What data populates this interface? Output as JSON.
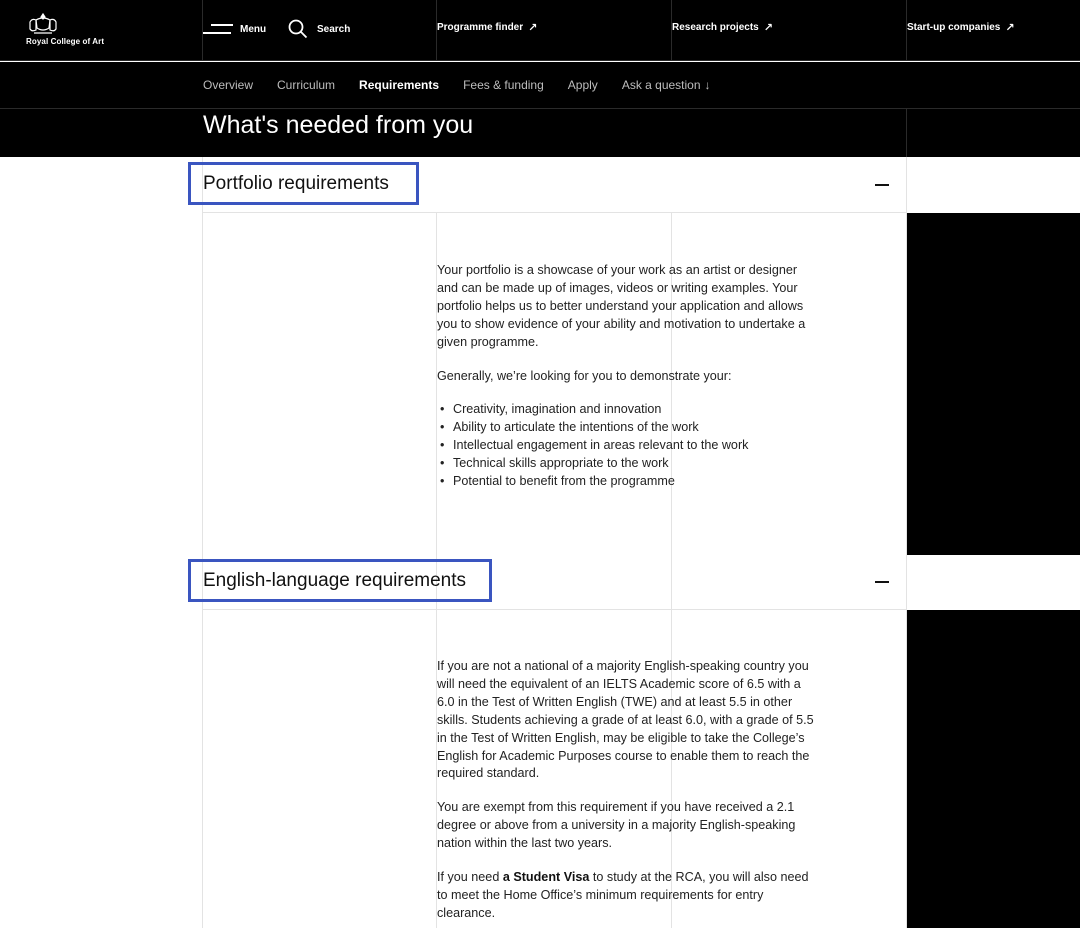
{
  "header": {
    "logo_text": "Royal College of Art",
    "menu_label": "Menu",
    "search_label": "Search",
    "links": [
      {
        "label": "Programme finder",
        "icon": "arrow-up-right-icon"
      },
      {
        "label": "Research projects",
        "icon": "arrow-up-right-icon"
      },
      {
        "label": "Start-up companies",
        "icon": "arrow-up-right-icon"
      }
    ],
    "arrow_glyph": "↗"
  },
  "subnav": {
    "items": [
      "Overview",
      "Curriculum",
      "Requirements",
      "Fees & funding",
      "Apply",
      "Ask a question"
    ],
    "active": "Requirements",
    "down_glyph": "↓"
  },
  "hero": {
    "title": "What's needed from you"
  },
  "portfolio": {
    "heading": "Portfolio requirements",
    "para1": "Your portfolio is a showcase of your work as an artist or designer and can be made up of images, videos or writing examples. Your portfolio helps us to better understand your application and allows you to show evidence of your ability and motivation to undertake a given programme.",
    "para2": "Generally, we’re looking for you to demonstrate your:",
    "bullets": [
      "Creativity, imagination and innovation",
      "Ability to articulate the intentions of the work",
      "Intellectual engagement in areas relevant to the work",
      "Technical skills appropriate to the work",
      "Potential to benefit from the programme"
    ]
  },
  "english": {
    "heading": "English-language requirements",
    "para1": "If you are not a national of a majority English-speaking country you will need the equivalent of an IELTS Academic score of 6.5 with a 6.0 in the Test of Written English (TWE) and at least 5.5 in other skills. Students achieving a grade of at least 6.0, with a grade of 5.5 in the Test of Written English, may be eligible to take the College’s English for Academic Purposes course to enable them to reach the required standard.",
    "para2": "You are exempt from this requirement if you have received a 2.1 degree or above from a university in a majority English-speaking nation within the last two years.",
    "para3_pre": "If you need ",
    "para3_bold": "a Student Visa",
    "para3_post": " to study at the RCA, you will also need to meet the Home Office’s minimum requirements for entry clearance."
  },
  "colors": {
    "highlight": "#3a55c0",
    "background_dark": "#000000",
    "grid": "#e3e3e3"
  }
}
